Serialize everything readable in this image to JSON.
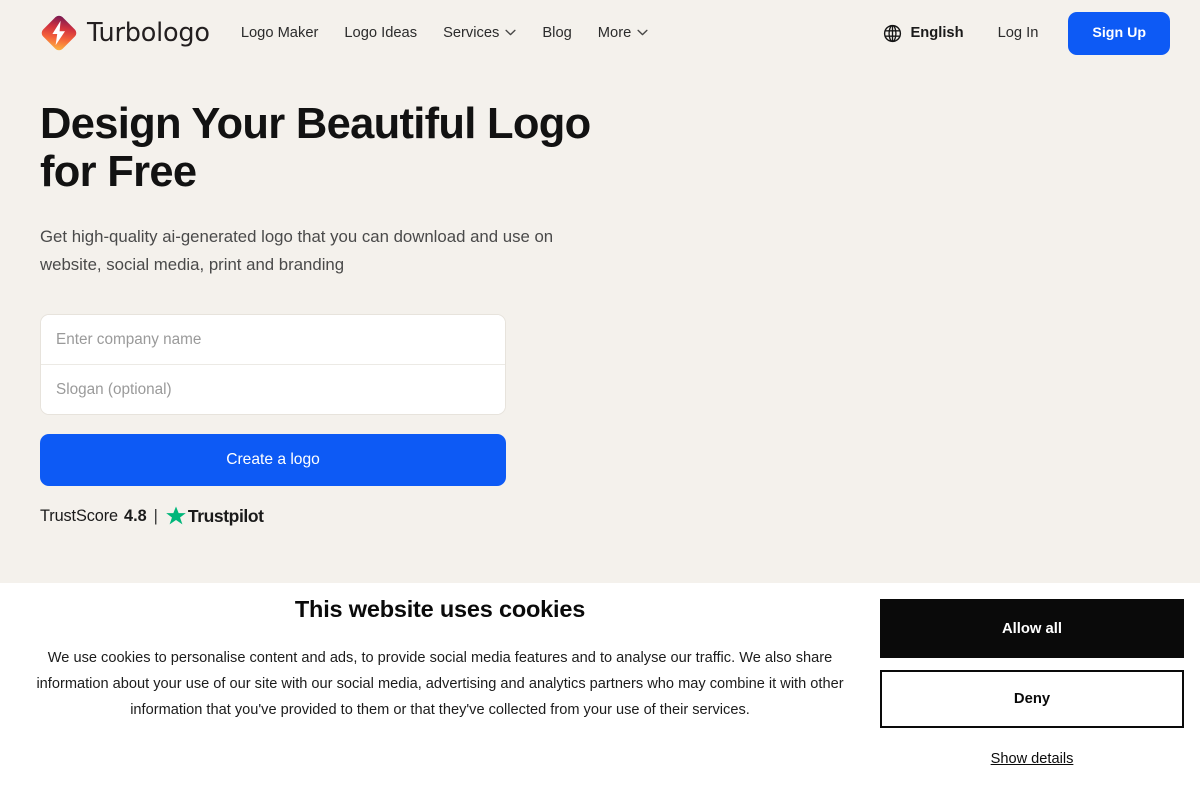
{
  "theme": {
    "page_bg": "#f4f1ec",
    "banner_bg": "#ffffff",
    "accent_blue": "#0d5af5",
    "trustpilot_green": "#00b67a",
    "text_dark": "#1a1a1a",
    "text_muted": "#4a4a4a",
    "placeholder": "#9a9a9a",
    "logo_gradient_from": "#7b1b52",
    "logo_gradient_mid": "#e8443c",
    "logo_gradient_to": "#fbb040"
  },
  "header": {
    "brand": {
      "wordmark": "Turbologo",
      "mark_icon": "turbologo-diamond-flame-icon"
    },
    "nav": [
      {
        "label": "Logo Maker",
        "has_chevron": false
      },
      {
        "label": "Logo Ideas",
        "has_chevron": false
      },
      {
        "label": "Services",
        "has_chevron": true
      },
      {
        "label": "Blog",
        "has_chevron": false
      },
      {
        "label": "More",
        "has_chevron": true
      }
    ],
    "language": {
      "icon": "globe-icon",
      "label": "English"
    },
    "login_label": "Log In",
    "signup_label": "Sign Up"
  },
  "hero": {
    "title": "Design Your Beautiful Logo for Free",
    "subtitle": "Get high-quality ai-generated logo that you can download and use on website, social media, print and branding",
    "form": {
      "company_value": "",
      "company_placeholder": "Enter company name",
      "slogan_value": "",
      "slogan_placeholder": "Slogan (optional)",
      "submit_label": "Create a logo"
    },
    "trust": {
      "label": "TrustScore",
      "score": "4.8",
      "separator": "|",
      "brand": "Trustpilot",
      "star_icon": "star-icon"
    }
  },
  "cookie_banner": {
    "title": "This website uses cookies",
    "body": "We use cookies to personalise content and ads, to provide social media features and to analyse our traffic. We also share information about your use of our site with our social media, advertising and analytics partners who may combine it with other information that you've provided to them or that they've collected from your use of their services.",
    "allow_label": "Allow all",
    "deny_label": "Deny",
    "details_label": "Show details"
  }
}
